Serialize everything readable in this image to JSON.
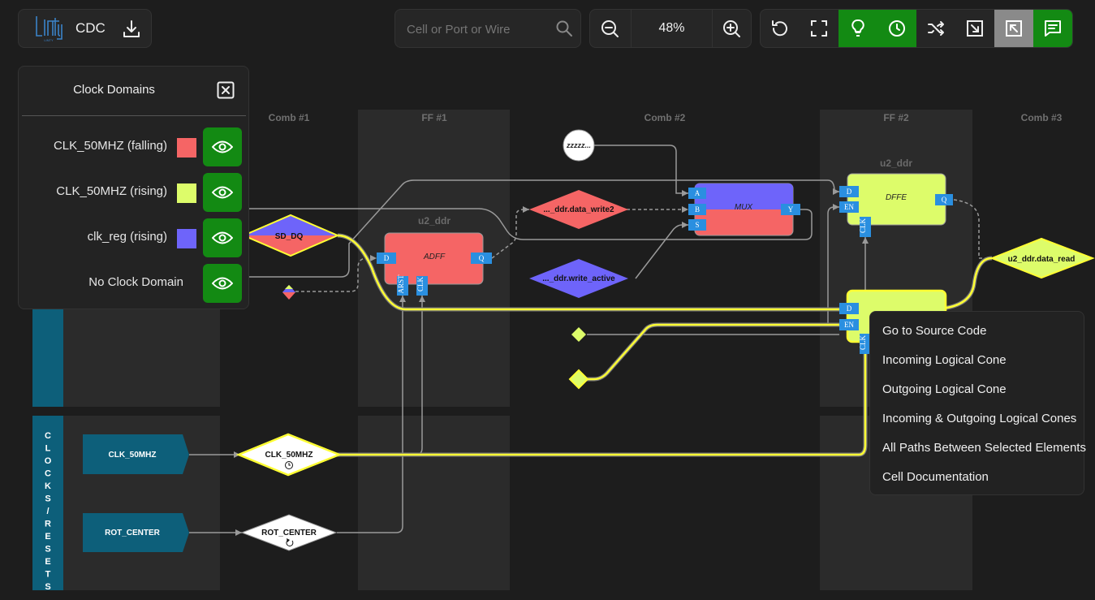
{
  "header": {
    "logo_text": "LINTY",
    "app_name": "CDC",
    "search_placeholder": "Cell or Port or Wire",
    "zoom": "48%"
  },
  "toolbar_icons": [
    "zoom-out-icon",
    "zoom-in-icon",
    "reset-icon",
    "fullscreen-icon",
    "lightbulb-icon",
    "clock-icon",
    "shuffle-icon",
    "arrow-down-right-icon",
    "arrow-up-left-icon",
    "comment-icon"
  ],
  "colors": {
    "accent_green": "#138a13",
    "highlight_yellow": "#ffff33",
    "falling": "#f56565",
    "rising": "#ddfc6a",
    "clk_reg": "#6e64fa",
    "clock_group": "#0d5f7a"
  },
  "clock_panel": {
    "title": "Clock Domains",
    "domains": [
      {
        "label": "CLK_50MHZ (falling)",
        "color": "#f56565"
      },
      {
        "label": "CLK_50MHZ (rising)",
        "color": "#ddfc6a"
      },
      {
        "label": "clk_reg (rising)",
        "color": "#6e64fa"
      },
      {
        "label": "No Clock Domain",
        "color": ""
      }
    ]
  },
  "columns": [
    "Comb #1",
    "FF #1",
    "Comb #2",
    "FF #2",
    "Comb #3"
  ],
  "schematic": {
    "clock_group_label": "CLOCKS / RESETS",
    "nodes": {
      "zzz": "zzzzz...",
      "sd_dq": "SD_DQ",
      "adff": {
        "instance": "u2_ddr",
        "type": "ADFF",
        "ports": [
          "D",
          "Q",
          "ARST",
          "CLK"
        ]
      },
      "data_write2": "..._ddr.data_write2",
      "write_active": "..._ddr.write_active",
      "mux": {
        "type": "MUX",
        "ports": [
          "A",
          "B",
          "S",
          "Y"
        ]
      },
      "dffe": {
        "instance": "u2_ddr",
        "type": "DFFE",
        "ports": [
          "D",
          "EN",
          "CLK",
          "Q"
        ]
      },
      "dffe2": {
        "ports": [
          "D",
          "EN",
          "CLK"
        ]
      },
      "data_read": "u2_ddr.data_read",
      "clk_port": "CLK_50MHZ",
      "clk_buf": "CLK_50MHZ",
      "rot_port": "ROT_CENTER",
      "rot_buf": "ROT_CENTER"
    }
  },
  "context_menu": {
    "items": [
      "Go to Source Code",
      "Incoming Logical Cone",
      "Outgoing Logical Cone",
      "Incoming & Outgoing Logical Cones",
      "All Paths Between Selected Elements",
      "Cell Documentation"
    ]
  }
}
